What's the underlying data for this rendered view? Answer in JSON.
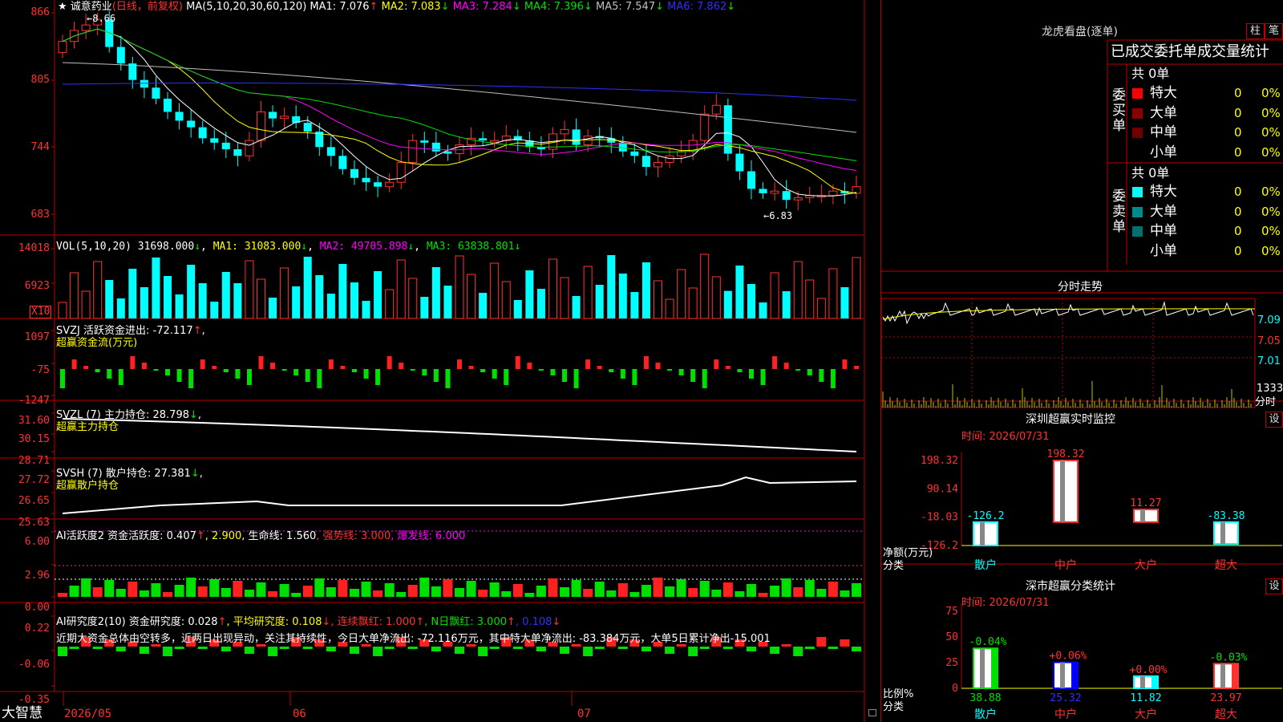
{
  "app": {
    "brand": "大智慧"
  },
  "main_chart": {
    "stock_name": "诚意药业",
    "period_label": "(日线，前复权)",
    "ma_label": "MA(5,10,20,30,60,120)",
    "ma_values": [
      {
        "name": "MA1",
        "value": "7.076",
        "dir": "↑"
      },
      {
        "name": "MA2",
        "value": "7.083",
        "dir": "↓"
      },
      {
        "name": "MA3",
        "value": "7.284",
        "dir": "↓"
      },
      {
        "name": "MA4",
        "value": "7.396",
        "dir": "↓"
      },
      {
        "name": "MA5",
        "value": "7.547",
        "dir": "↓"
      },
      {
        "name": "MA6",
        "value": "7.862",
        "dir": "↓"
      }
    ],
    "y_ticks": [
      "866",
      "805",
      "744",
      "683"
    ],
    "high_label": "←8.66",
    "low_label": "←6.83",
    "colors": {
      "up": "#ff3232",
      "down": "#00ffff",
      "ma1": "#ffffff",
      "ma2": "#ffff00",
      "ma3": "#ff00ff",
      "ma4": "#00e000",
      "ma5": "#c0c0c0",
      "ma6": "#3030ff"
    }
  },
  "vol": {
    "label": "VOL(5,10,20)",
    "value": "31698.000",
    "value_dir": "↓",
    "ma1": {
      "name": "MA1",
      "value": "31083.000",
      "dir": "↓"
    },
    "ma2": {
      "name": "MA2",
      "value": "49705.898",
      "dir": "↓"
    },
    "ma3": {
      "name": "MA3",
      "value": "63838.801",
      "dir": "↓"
    },
    "y_ticks": [
      "14018",
      "6923"
    ],
    "unit": "X10"
  },
  "svzj": {
    "label": "SVZJ",
    "text": "活跃资金进出: -72.117",
    "dir": "↑",
    "subtitle": "超赢资金流(万元)",
    "y_ticks": [
      "1097",
      "-75",
      "-1247"
    ]
  },
  "svzl": {
    "label": "SVZL (7)",
    "text": "主力持仓: 28.798",
    "dir": "↓",
    "subtitle": "超赢主力持仓",
    "y_ticks": [
      "31.60",
      "30.15",
      "28.71"
    ]
  },
  "svsh": {
    "label": "SVSH (7)",
    "text": "散户持仓: 27.381",
    "dir": "↓",
    "subtitle": "超赢散户持仓",
    "y_ticks": [
      "27.72",
      "26.65",
      "25.63"
    ]
  },
  "ai_active": {
    "label": "AI活跃度2",
    "text1": "资金活跃度: 0.407",
    "dir1": "↑",
    "text2": ", 2.900",
    "text3": ", 生命线: 1.560",
    "text4": ", 强势线: 3.000",
    "text5": ", 爆发线: 6.000",
    "y_ticks": [
      "6.00",
      "2.96",
      "0.00"
    ]
  },
  "ai_research": {
    "label": "AI研究度2(10)",
    "text1": "资金研究度: 0.028",
    "text2": ", 平均研究度: 0.108",
    "text3": ", 连续飘红: 1.000",
    "text4": ", N日飘红: 3.000",
    "text5": ", 0.108",
    "comment": "近期大资金总体由空转多，近两日出现异动，关注其持续性，今日大单净流出: -72.116万元，其中特大单净流出: -83.384万元，大单5日累计净出-15.001",
    "y_ticks": [
      "0.22",
      "-0.06",
      "-0.35"
    ]
  },
  "x_axis": {
    "labels": [
      "2026/05",
      "06",
      "07"
    ]
  },
  "right": {
    "lhb_title": "龙虎看盘(逐单)",
    "btn_pillar": "柱",
    "btn_stroke": "笔",
    "stat_title": "已成交委托单成交量统计",
    "buy_label": "委买单",
    "sell_label": "委卖单",
    "buy_total": "共 0单",
    "sell_total": "共 0单",
    "rows": [
      {
        "name": "特大",
        "count": "0",
        "pct": "0%"
      },
      {
        "name": "大单",
        "count": "0",
        "pct": "0%"
      },
      {
        "name": "中单",
        "count": "0",
        "pct": "0%"
      },
      {
        "name": "小单",
        "count": "0",
        "pct": "0%"
      }
    ],
    "buy_colors": [
      "#ff0000",
      "#8b0000",
      "#700000",
      "#000000"
    ],
    "sell_colors": [
      "#00ffff",
      "#008b8b",
      "#007070",
      "#000000"
    ],
    "intraday_title": "分时走势",
    "intraday_ticks": [
      "7.09",
      "7.05",
      "7.01"
    ],
    "intraday_vol": "1333",
    "intraday_vol_label": "分时",
    "sz_title": "深圳超赢实时监控",
    "sz_btn": "设",
    "sz_time": "时间: 2026/07/31",
    "sz_yticks": [
      "198.32",
      "90.14",
      "-18.03",
      "-126.2"
    ],
    "sz_ylabel1": "净额(万元)",
    "sz_ylabel2": "分类",
    "sz_bars": [
      {
        "cat": "散户",
        "value": -126.2,
        "label": "-126.2"
      },
      {
        "cat": "中户",
        "value": 198.32,
        "label": "198.32"
      },
      {
        "cat": "大户",
        "value": 11.27,
        "label": "11.27"
      },
      {
        "cat": "超大",
        "value": -83.38,
        "label": "-83.38"
      }
    ],
    "sc_title": "深市超赢分类统计",
    "sc_btn": "设",
    "sc_time": "时间: 2026/07/31",
    "sc_yticks": [
      "75",
      "50",
      "25",
      "0"
    ],
    "sc_ylabel1": "比例%",
    "sc_ylabel2": "分类",
    "sc_bars": [
      {
        "cat": "散户",
        "value": 38.88,
        "label": "38.88",
        "change": "-0.04%"
      },
      {
        "cat": "中户",
        "value": 25.32,
        "label": "25.32",
        "change": "+0.06%"
      },
      {
        "cat": "大户",
        "value": 11.82,
        "label": "11.82",
        "change": "+0.00%"
      },
      {
        "cat": "超大",
        "value": 23.97,
        "label": "23.97",
        "change": "-0.03%"
      }
    ]
  }
}
